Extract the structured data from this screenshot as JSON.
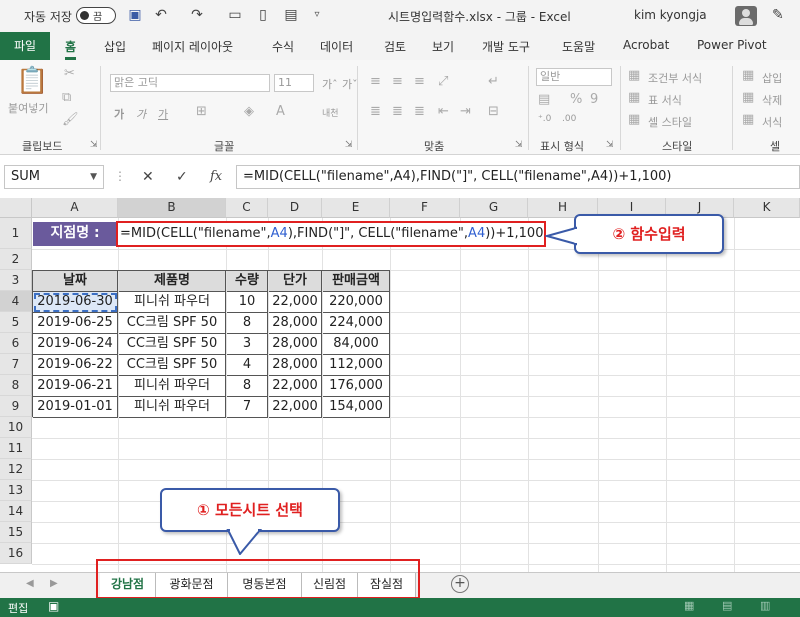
{
  "titlebar": {
    "autosave_label": "자동 저장",
    "autosave_state": "끔",
    "filename": "시트명입력함수.xlsx  -  그룹  -  Excel",
    "user": "kim kyongja"
  },
  "ribbon_tabs": [
    "파일",
    "홈",
    "삽입",
    "페이지 레이아웃",
    "수식",
    "데이터",
    "검토",
    "보기",
    "개발 도구",
    "도움말",
    "Acrobat",
    "Power Pivot"
  ],
  "ribbon": {
    "clipboard": {
      "paste": "붙여넣기",
      "label": "클립보드"
    },
    "font": {
      "name": "맑은 고딕",
      "size": "11",
      "bold": "가",
      "italic": "가",
      "underline": "가",
      "phonetic": "내천",
      "label": "글꼴"
    },
    "align": {
      "label": "맞춤"
    },
    "number": {
      "format": "일반",
      "label": "표시 형식"
    },
    "style": {
      "conditional": "조건부 서식",
      "table": "표 서식",
      "cell": "셀 스타일",
      "label": "스타일"
    },
    "cells": {
      "insert": "삽입",
      "delete": "삭제",
      "format": "서식",
      "label": "셀"
    }
  },
  "formula_bar": {
    "name_box": "SUM",
    "formula": "=MID(CELL(\"filename\",A4),FIND(\"]\", CELL(\"filename\",A4))+1,100)"
  },
  "columns": [
    "A",
    "B",
    "C",
    "D",
    "E",
    "F",
    "G",
    "H",
    "I",
    "J",
    "K"
  ],
  "rows": [
    "1",
    "2",
    "3",
    "4",
    "5",
    "6",
    "7",
    "8",
    "9",
    "10",
    "11",
    "12",
    "13",
    "14",
    "15",
    "16"
  ],
  "cells": {
    "a1": "지점명 :",
    "b1_prefix": "=MID(CELL(\"filename\",",
    "b1_ref1": "A4",
    "b1_mid": "),FIND(\"]\", CELL(\"filename\",",
    "b1_ref2": "A4",
    "b1_suffix": "))+1,100)"
  },
  "table": {
    "headers": [
      "날짜",
      "제품명",
      "수량",
      "단가",
      "판매금액"
    ],
    "rows": [
      [
        "2019-06-30",
        "피니쉬 파우더",
        "10",
        "22,000",
        "220,000"
      ],
      [
        "2019-06-25",
        "CC크림 SPF 50",
        "8",
        "28,000",
        "224,000"
      ],
      [
        "2019-06-24",
        "CC크림 SPF 50",
        "3",
        "28,000",
        "84,000"
      ],
      [
        "2019-06-22",
        "CC크림 SPF 50",
        "4",
        "28,000",
        "112,000"
      ],
      [
        "2019-06-21",
        "피니쉬 파우더",
        "8",
        "22,000",
        "176,000"
      ],
      [
        "2019-01-01",
        "피니쉬 파우더",
        "7",
        "22,000",
        "154,000"
      ]
    ]
  },
  "callouts": {
    "input": "② 함수입력",
    "select": "① 모든시트 선택"
  },
  "sheets": [
    "강남점",
    "광화문점",
    "명동본점",
    "신림점",
    "잠실점"
  ],
  "statusbar": {
    "mode": "편집"
  },
  "colors": {
    "excel_green": "#217346",
    "label_purple": "#6a5a9c",
    "highlight_red": "#e02020",
    "callout_border": "#3a5aa8"
  }
}
